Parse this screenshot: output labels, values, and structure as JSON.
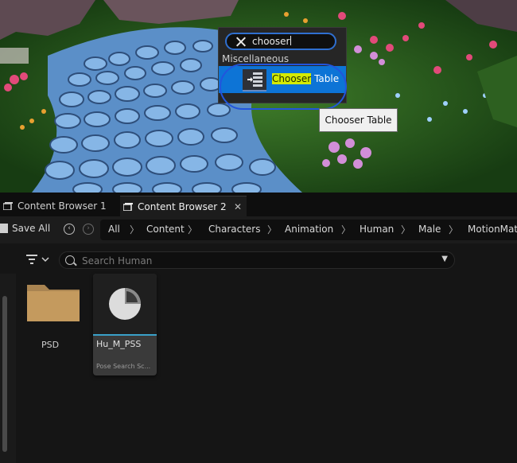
{
  "popup": {
    "search_value": "chooser",
    "category": "Miscellaneous",
    "result_highlight": "Chooser",
    "result_rest": " Table"
  },
  "tooltip": {
    "text": "Chooser Table"
  },
  "tabs": [
    {
      "label": "Content Browser 1",
      "active": false
    },
    {
      "label": "Content Browser 2",
      "active": true
    }
  ],
  "toolbar": {
    "save_all": "Save All",
    "breadcrumbs": [
      "All",
      "Content",
      "Characters",
      "Animation",
      "Human",
      "Male",
      "MotionMat"
    ]
  },
  "search": {
    "placeholder": "Search Human"
  },
  "assets": [
    {
      "name": "PSD",
      "kind": "folder"
    },
    {
      "name": "Hu_M_PSS",
      "type": "Pose Search Sc..."
    }
  ],
  "colors": {
    "accent": "#0d74d6",
    "highlight": "#d5ea00",
    "annotation": "#2255dd"
  }
}
